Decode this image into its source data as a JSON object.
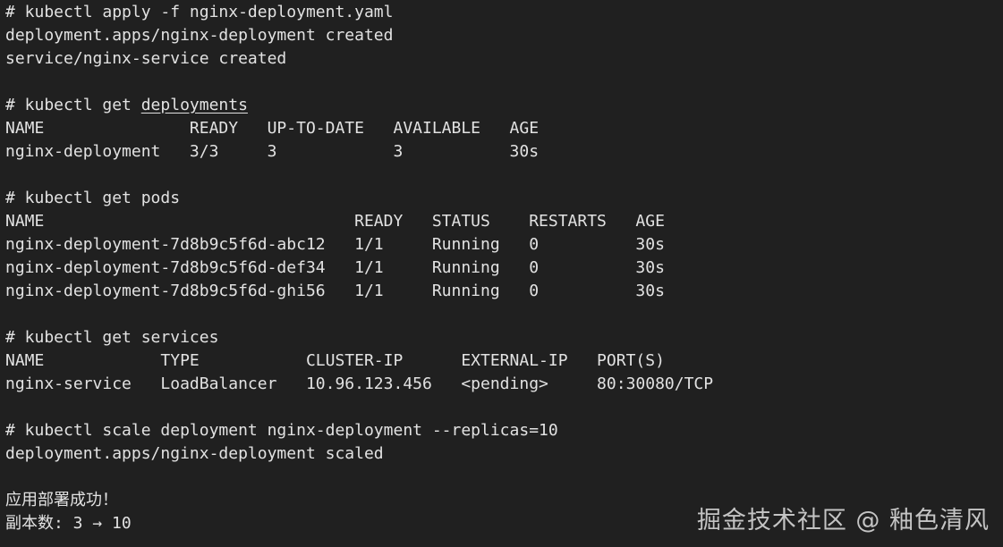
{
  "colors": {
    "background": "#202020",
    "text": "#e2e2e2",
    "watermark": "#c4c4c4"
  },
  "sections": {
    "apply": {
      "command": "# kubectl apply -f nginx-deployment.yaml",
      "output": [
        "deployment.apps/nginx-deployment created",
        "service/nginx-service created"
      ]
    },
    "get_deployments": {
      "command_prefix": "# kubectl get ",
      "command_underlined": "deployments"
    },
    "get_pods": {
      "command": "# kubectl get pods"
    },
    "get_services": {
      "command": "# kubectl get services"
    },
    "scale": {
      "command": "# kubectl scale deployment nginx-deployment --replicas=10",
      "output": [
        "deployment.apps/nginx-deployment scaled"
      ]
    },
    "summary": {
      "line1": "应用部署成功！",
      "line2": "副本数: 3 → 10"
    }
  },
  "tables": {
    "deployments": {
      "columns": [
        "NAME",
        "READY",
        "UP-TO-DATE",
        "AVAILABLE",
        "AGE"
      ],
      "col_starts": [
        0,
        19,
        27,
        40,
        52
      ],
      "rows": [
        [
          "nginx-deployment",
          "3/3",
          "3",
          "3",
          "30s"
        ]
      ]
    },
    "pods": {
      "columns": [
        "NAME",
        "READY",
        "STATUS",
        "RESTARTS",
        "AGE"
      ],
      "col_starts": [
        0,
        36,
        44,
        54,
        65
      ],
      "rows": [
        [
          "nginx-deployment-7d8b9c5f6d-abc12",
          "1/1",
          "Running",
          "0",
          "30s"
        ],
        [
          "nginx-deployment-7d8b9c5f6d-def34",
          "1/1",
          "Running",
          "0",
          "30s"
        ],
        [
          "nginx-deployment-7d8b9c5f6d-ghi56",
          "1/1",
          "Running",
          "0",
          "30s"
        ]
      ]
    },
    "services": {
      "columns": [
        "NAME",
        "TYPE",
        "CLUSTER-IP",
        "EXTERNAL-IP",
        "PORT(S)"
      ],
      "col_starts": [
        0,
        16,
        31,
        47,
        61
      ],
      "rows": [
        [
          "nginx-service",
          "LoadBalancer",
          "10.96.123.456",
          "<pending>",
          "80:30080/TCP"
        ]
      ]
    }
  },
  "watermark": "掘金技术社区 @ 釉色清风"
}
